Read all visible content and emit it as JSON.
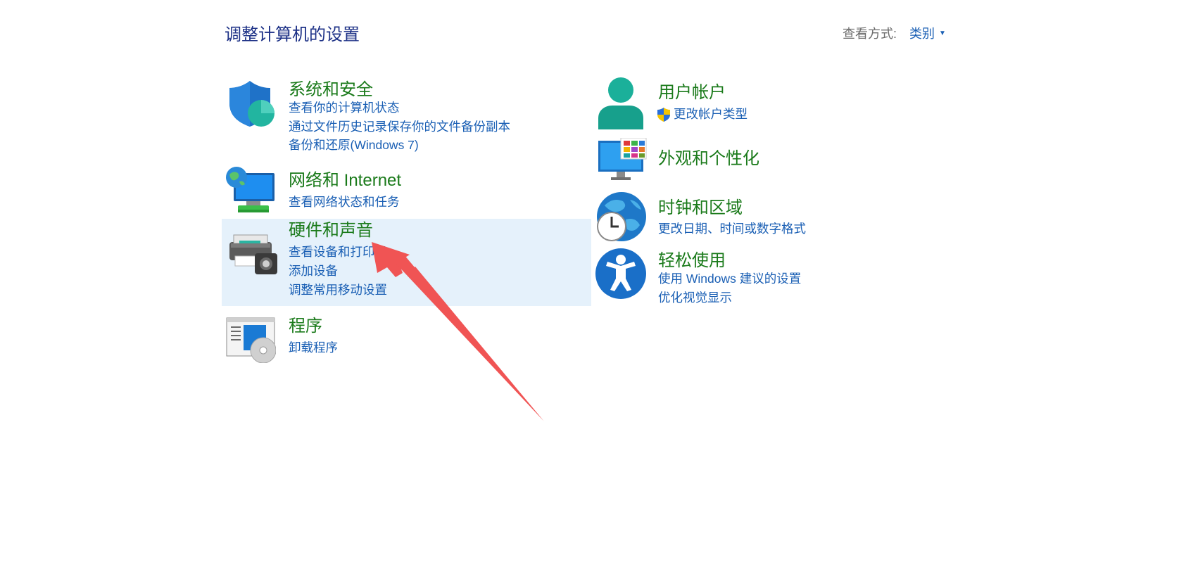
{
  "page": {
    "title": "调整计算机的设置"
  },
  "view_by": {
    "label": "查看方式:",
    "value": "类别"
  },
  "left": [
    {
      "title": "系统和安全",
      "icon": "shield-icon",
      "links": [
        "查看你的计算机状态",
        "通过文件历史记录保存你的文件备份副本",
        "备份和还原(Windows 7)"
      ]
    },
    {
      "title": "网络和 Internet",
      "icon": "network-monitor-icon",
      "links": [
        "查看网络状态和任务"
      ]
    },
    {
      "title": "硬件和声音",
      "icon": "printer-speaker-icon",
      "links": [
        "查看设备和打印机",
        "添加设备",
        "调整常用移动设置"
      ]
    },
    {
      "title": "程序",
      "icon": "programs-disc-icon",
      "links": [
        "卸载程序"
      ]
    }
  ],
  "right": [
    {
      "title": "用户帐户",
      "icon": "user-icon",
      "links": [
        "更改帐户类型"
      ]
    },
    {
      "title": "外观和个性化",
      "icon": "monitor-tiles-icon",
      "links": []
    },
    {
      "title": "时钟和区域",
      "icon": "globe-clock-icon",
      "links": [
        "更改日期、时间或数字格式"
      ]
    },
    {
      "title": "轻松使用",
      "icon": "accessibility-icon",
      "links": [
        "使用 Windows 建议的设置",
        "优化视觉显示"
      ]
    }
  ],
  "colors": {
    "title_blue": "#1e3287",
    "link_blue": "#1a5fb4",
    "category_green": "#1a7a1a",
    "hover_bg": "#e5f1fb",
    "arrow_red": "#f05454"
  }
}
